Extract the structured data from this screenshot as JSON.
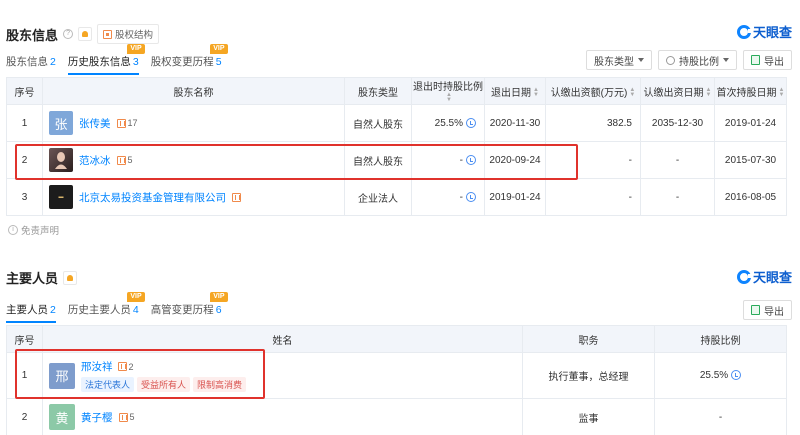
{
  "brand": {
    "logo_text": "天眼查"
  },
  "shareholders": {
    "title": "股东信息",
    "equity_chip": "股权结构",
    "tabs": [
      {
        "label": "股东信息",
        "count": "2",
        "active": false,
        "vip": false
      },
      {
        "label": "历史股东信息",
        "count": "3",
        "active": true,
        "vip": true
      },
      {
        "label": "股权变更历程",
        "count": "5",
        "active": false,
        "vip": true
      }
    ],
    "vip_badge": "VIP",
    "buttons": {
      "type": "股东类型",
      "ratio": "持股比例",
      "export": "导出"
    },
    "columns": [
      "序号",
      "股东名称",
      "股东类型",
      "退出时持股比例",
      "退出日期",
      "认缴出资额(万元)",
      "认缴出资日期",
      "首次持股日期"
    ],
    "rows": [
      {
        "no": "1",
        "avatar": "张",
        "avatar_color": "#7fa7d9",
        "name": "张传美",
        "people": "17",
        "type": "自然人股东",
        "ratio": "25.5%",
        "exit_date": "2020-11-30",
        "amount": "382.5",
        "sub_date": "2035-12-30",
        "first_date": "2019-01-24"
      },
      {
        "no": "2",
        "avatar": "",
        "avatar_color": "#3a2b2b",
        "name": "范冰冰",
        "people": "5",
        "type": "自然人股东",
        "ratio": "-",
        "exit_date": "2020-09-24",
        "amount": "-",
        "sub_date": "-",
        "first_date": "2015-07-30"
      },
      {
        "no": "3",
        "avatar": "",
        "avatar_color": "#1c1c1c",
        "name": "北京太易投资基金管理有限公司",
        "people": "",
        "type": "企业法人",
        "ratio": "-",
        "exit_date": "2019-01-24",
        "amount": "-",
        "sub_date": "-",
        "first_date": "2016-08-05"
      }
    ],
    "disclaimer": "免责声明"
  },
  "staff": {
    "title": "主要人员",
    "tabs": [
      {
        "label": "主要人员",
        "count": "2",
        "active": true,
        "vip": false
      },
      {
        "label": "历史主要人员",
        "count": "4",
        "active": false,
        "vip": true
      },
      {
        "label": "高管变更历程",
        "count": "6",
        "active": false,
        "vip": true
      }
    ],
    "buttons": {
      "export": "导出"
    },
    "columns": [
      "序号",
      "姓名",
      "职务",
      "持股比例"
    ],
    "rows": [
      {
        "no": "1",
        "avatar": "邢",
        "avatar_color": "#7e9ccc",
        "name": "邢汝祥",
        "people": "2",
        "tags": [
          "法定代表人",
          "受益所有人",
          "限制高消费"
        ],
        "position": "执行董事，总经理",
        "ratio": "25.5%"
      },
      {
        "no": "2",
        "avatar": "黄",
        "avatar_color": "#8cc9a7",
        "name": "黄子樱",
        "people": "5",
        "tags": [],
        "position": "监事",
        "ratio": "-"
      }
    ]
  },
  "colors": {
    "accent": "#0084ff",
    "highlight": "#e0322c",
    "vip": "#f5a623"
  }
}
